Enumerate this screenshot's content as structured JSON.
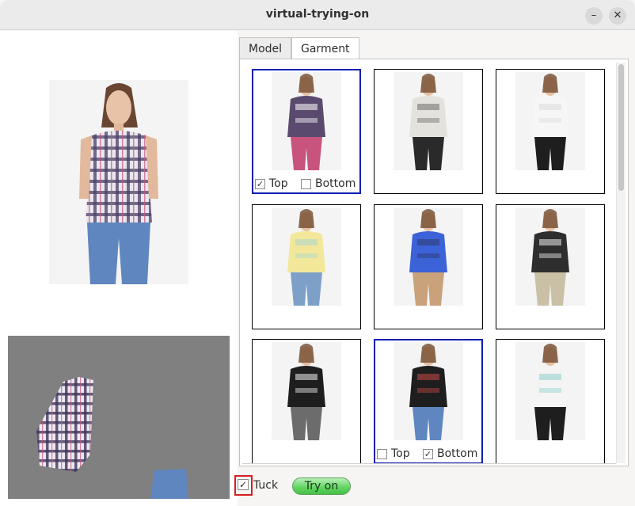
{
  "window": {
    "title": "virtual-trying-on",
    "minimize_glyph": "–",
    "close_glyph": "✕"
  },
  "tabs": [
    {
      "label": "Model",
      "active": false
    },
    {
      "label": "Garment",
      "active": true
    }
  ],
  "garments": [
    {
      "id": 1,
      "colors": [
        "#5a4a6e",
        "#ffffff",
        "#c8547e"
      ],
      "selected": true,
      "checks": [
        {
          "label": "Top",
          "checked": true
        },
        {
          "label": "Bottom",
          "checked": false
        }
      ]
    },
    {
      "id": 2,
      "colors": [
        "#e4e2dc",
        "#6c6c6c",
        "#2a2a2a"
      ],
      "selected": false
    },
    {
      "id": 3,
      "colors": [
        "#f6f6f6",
        "#dcdcdc",
        "#1e1e1e"
      ],
      "selected": false
    },
    {
      "id": 4,
      "colors": [
        "#f3e79a",
        "#a8d8d0",
        "#7da0c8"
      ],
      "selected": false
    },
    {
      "id": 5,
      "colors": [
        "#3c62d8",
        "#2d3a6a",
        "#c9a27b"
      ],
      "selected": false
    },
    {
      "id": 6,
      "colors": [
        "#2e2e2e",
        "#eeeeee",
        "#c9c0a6"
      ],
      "selected": false
    },
    {
      "id": 7,
      "colors": [
        "#1e1e1e",
        "#eeeeee",
        "#6c6c6c"
      ],
      "selected": false
    },
    {
      "id": 8,
      "colors": [
        "#1e1e1e",
        "#c84848",
        "#5f86bf"
      ],
      "selected": true,
      "checks": [
        {
          "label": "Top",
          "checked": false
        },
        {
          "label": "Bottom",
          "checked": true
        }
      ]
    },
    {
      "id": 9,
      "colors": [
        "#f4f4f4",
        "#8ed0cc",
        "#1e1e1e"
      ],
      "selected": false
    }
  ],
  "bottom": {
    "tuck_label": "Tuck",
    "tuck_checked": true,
    "tryon_label": "Try on"
  },
  "colors": {
    "selection_border": "#0a1fb4",
    "tuck_highlight": "#d42020",
    "tryon_green": "#5fd45f",
    "preview_bg": "#808080"
  }
}
